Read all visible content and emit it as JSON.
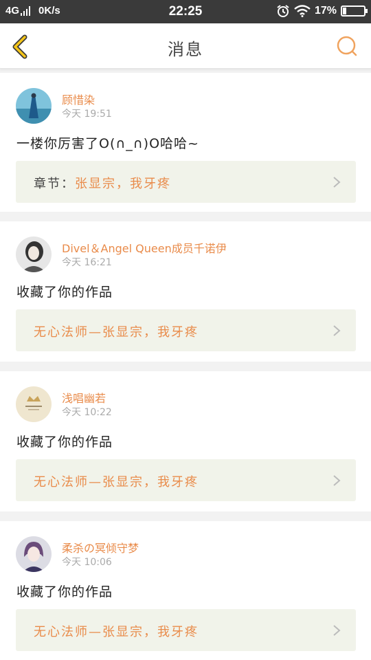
{
  "status_bar": {
    "network": "4G",
    "speed": "0K/s",
    "time": "22:25",
    "battery_percent": "17%",
    "battery_level": 0.17
  },
  "header": {
    "title": "消息",
    "accent_color": "#f5c518"
  },
  "messages": [
    {
      "user": "顾惜染",
      "time": "今天 19:51",
      "text": "一楼你厉害了O(∩_∩)O哈哈~",
      "ref_prefix": "章节：",
      "ref_title": "张显宗，我牙疼"
    },
    {
      "user": "Divel＆Angel Queen成员千诺伊",
      "time": "今天 16:21",
      "text": "收藏了你的作品",
      "ref_prefix": "",
      "ref_title": "无心法师—张显宗，我牙疼"
    },
    {
      "user": "浅唱幽若",
      "time": "今天 10:22",
      "text": "收藏了你的作品",
      "ref_prefix": "",
      "ref_title": "无心法师—张显宗，我牙疼"
    },
    {
      "user": "柔杀の冥倾守梦",
      "time": "今天 10:06",
      "text": "收藏了你的作品",
      "ref_prefix": "",
      "ref_title": "无心法师—张显宗，我牙疼"
    }
  ],
  "icons": {
    "back": "chevron-left-icon",
    "search": "search-icon",
    "ref": "chevron-right-icon"
  }
}
